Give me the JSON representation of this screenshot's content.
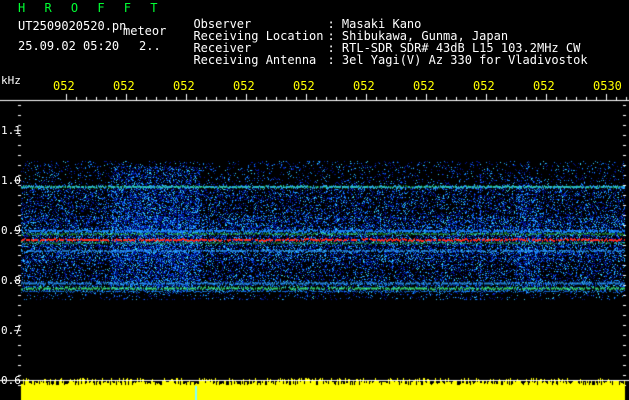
{
  "header": {
    "app_name": "H R O F F T",
    "file_name": "UT2509020520.pn",
    "mode_label": "meteor",
    "timestamp": "25.09.02 05:20",
    "page_indicator": "2..",
    "observer_label": "Observer",
    "observer_value": ": Masaki Kano",
    "location_label": "Receiving Location",
    "location_value": ": Shibukawa, Gunma, Japan",
    "receiver_label": "Receiver",
    "receiver_value": ": RTL-SDR SDR# 43dB L15 103.2MHz CW",
    "antenna_label": "Receiving Antenna",
    "antenna_value": ": 3el Yagi(V) Az 330 for Vladivostok"
  },
  "chart_data": {
    "type": "heatmap",
    "y_unit": "kHz",
    "y_ticks": [
      "1.1",
      "1.0",
      "0.9",
      "0.8",
      "0.7",
      "0.6"
    ],
    "x_ticks": [
      "052",
      "052",
      "052",
      "052",
      "052",
      "052",
      "052",
      "052",
      "052",
      "0530"
    ],
    "ylim": [
      0.6,
      1.15
    ]
  },
  "colors": {
    "background": "#000000",
    "noise_low": "#000040",
    "noise_mid": "#1060ff",
    "carrier": "#ff2020",
    "band": "#40ff40",
    "amplitude": "#ffff00",
    "text_header": "#ffffff",
    "text_time": "#ffff00",
    "text_brand": "#00ff33"
  }
}
